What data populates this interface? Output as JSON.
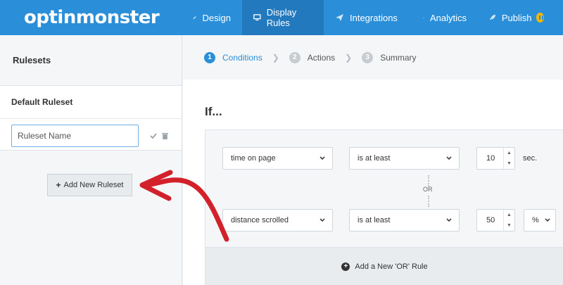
{
  "app": {
    "logo_text": "optinmonster"
  },
  "nav": {
    "items": [
      {
        "label": "Design",
        "icon": "pencil-icon"
      },
      {
        "label": "Display Rules",
        "icon": "monitor-icon",
        "active": true
      },
      {
        "label": "Integrations",
        "icon": "paper-plane-icon"
      },
      {
        "label": "Analytics",
        "icon": "chart-line-icon"
      },
      {
        "label": "Publish",
        "icon": "rocket-icon"
      }
    ]
  },
  "sidebar": {
    "title": "Rulesets",
    "ruleset": {
      "name": "Default Ruleset",
      "input_placeholder": "Ruleset Name",
      "input_value": ""
    },
    "add_button_label": "Add New Ruleset"
  },
  "steps": [
    {
      "num": "1",
      "label": "Conditions",
      "active": true
    },
    {
      "num": "2",
      "label": "Actions"
    },
    {
      "num": "3",
      "label": "Summary"
    }
  ],
  "main": {
    "title": "If...",
    "rules": [
      {
        "condition": "time on page",
        "operator": "is at least",
        "value": "10",
        "unit": "sec."
      },
      {
        "condition": "distance scrolled",
        "operator": "is at least",
        "value": "50",
        "unit": "%"
      }
    ],
    "or_label": "OR",
    "add_or_label": "Add a New 'OR' Rule"
  },
  "colors": {
    "brand": "#2a8fd8",
    "nav_active": "#2279bd",
    "badge": "#f5b800",
    "annotation": "#d3212b"
  }
}
